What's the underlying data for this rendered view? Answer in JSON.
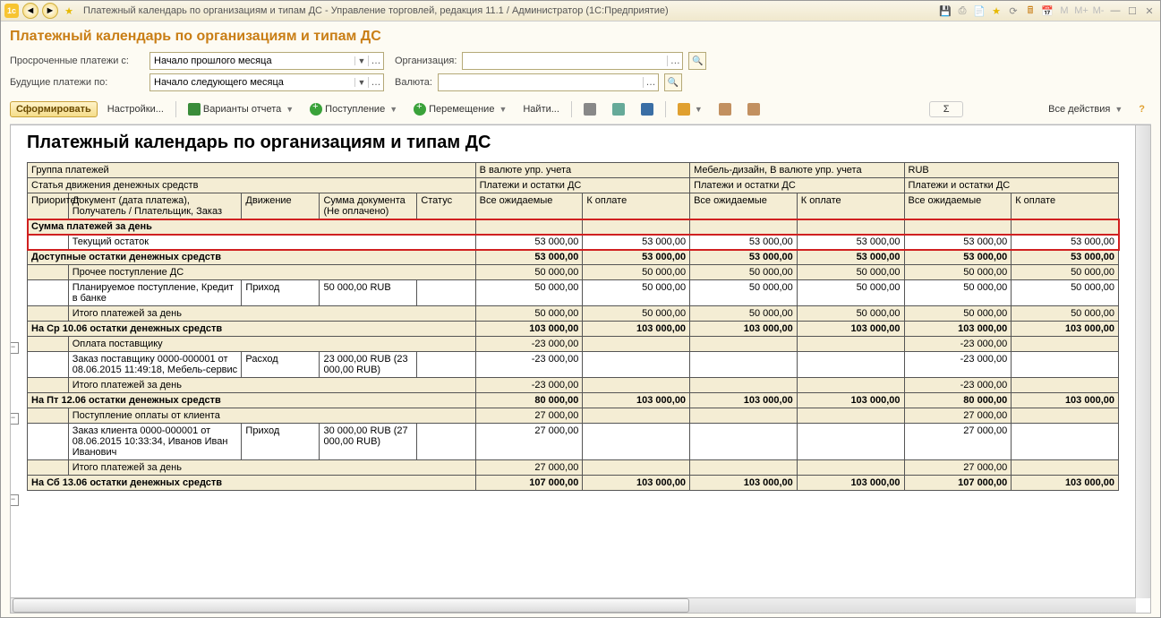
{
  "window": {
    "title": "Платежный календарь по организациям и типам ДС - Управление торговлей, редакция 11.1 / Администратор  (1С:Предприятие)"
  },
  "page": {
    "heading": "Платежный календарь по организациям и типам ДС"
  },
  "filters": {
    "overdue_label": "Просроченные платежи с:",
    "overdue_value": "Начало прошлого месяца",
    "future_label": "Будущие платежи по:",
    "future_value": "Начало следующего месяца",
    "org_label": "Организация:",
    "org_value": "",
    "currency_label": "Валюта:",
    "currency_value": ""
  },
  "toolbar": {
    "generate": "Сформировать",
    "settings": "Настройки...",
    "variants": "Варианты отчета",
    "income": "Поступление",
    "transfer": "Перемещение",
    "find": "Найти...",
    "all_actions": "Все действия"
  },
  "report": {
    "title": "Платежный календарь по организациям и типам ДС",
    "header": {
      "group": "Группа платежей",
      "col_b_top": "В валюте упр. учета",
      "col_c_top": "Мебель-дизайн, В валюте упр. учета",
      "col_d_top": "RUB",
      "cashflow_article": "Статья движения денежных средств",
      "payments_balance": "Платежи и остатки ДС",
      "priority": "Приоритет",
      "doc": "Документ (дата платежа), Получатель / Плательщик, Заказ",
      "movement": "Движение",
      "amount": "Сумма документа (Не оплачено)",
      "status": "Статус",
      "expected": "Все ожидаемые",
      "topay": "К оплате"
    },
    "rows": {
      "r_sum_day": "Сумма платежей за день",
      "r_current_balance": "Текущий остаток",
      "r_available": "Доступные остатки денежных средств",
      "r_other_income": "Прочее поступление ДС",
      "r_planned_income": "Планируемое поступление, Кредит в банке",
      "mv_income": "Приход",
      "mv_expense": "Расход",
      "amt_50k": "50 000,00 RUB",
      "r_total_day": "Итого платежей за день",
      "r_wed_1006": "На Ср 10.06 остатки денежных средств",
      "r_supplier_pay": "Оплата поставщику",
      "r_supplier_order": "Заказ поставщику 0000-000001 от 08.06.2015 11:49:18, Мебель-сервис",
      "amt_23k": "23 000,00 RUB (23 000,00 RUB)",
      "r_fri_1206": "На Пт 12.06 остатки денежных средств",
      "r_client_pay": "Поступление оплаты от клиента",
      "r_client_order": "Заказ клиента 0000-000001 от 08.06.2015 10:33:34, Иванов Иван Иванович",
      "amt_30k": "30 000,00 RUB (27 000,00 RUB)",
      "r_sat_1306": "На Сб 13.06 остатки денежных средств"
    },
    "vals": {
      "v53": "53 000,00",
      "v50": "50 000,00",
      "v103": "103 000,00",
      "vm23": "-23 000,00",
      "v80": "80 000,00",
      "v27": "27 000,00",
      "v107": "107 000,00"
    }
  }
}
